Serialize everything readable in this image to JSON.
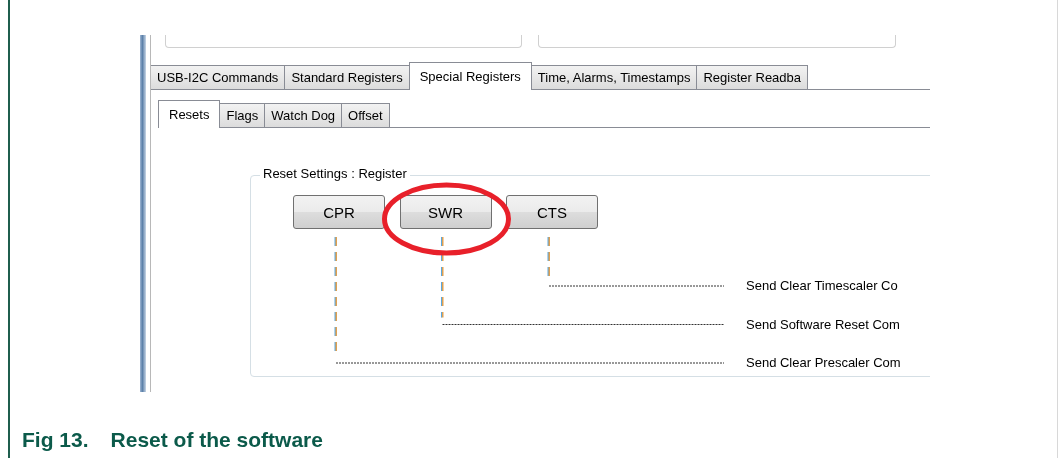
{
  "screenshot": {
    "tabs": [
      {
        "label": "USB-I2C Commands",
        "selected": false
      },
      {
        "label": "Standard Registers",
        "selected": false
      },
      {
        "label": "Special Registers",
        "selected": true
      },
      {
        "label": "Time, Alarms, Timestamps",
        "selected": false
      },
      {
        "label": "Register Readba",
        "selected": false
      }
    ],
    "subtabs": [
      {
        "label": "Resets",
        "selected": true
      },
      {
        "label": "Flags",
        "selected": false
      },
      {
        "label": "Watch Dog",
        "selected": false
      },
      {
        "label": "Offset",
        "selected": false
      }
    ],
    "group": {
      "title": "Reset Settings : Register",
      "buttons": [
        {
          "label": "CPR",
          "highlighted": false
        },
        {
          "label": "SWR",
          "highlighted": true
        },
        {
          "label": "CTS",
          "highlighted": false
        }
      ],
      "commands": [
        {
          "label": "Send Clear Timescaler Co"
        },
        {
          "label": "Send Software Reset Com"
        },
        {
          "label": "Send Clear Prescaler Com"
        }
      ]
    }
  },
  "caption": {
    "number": "Fig 13.",
    "title": "Reset of the software"
  }
}
